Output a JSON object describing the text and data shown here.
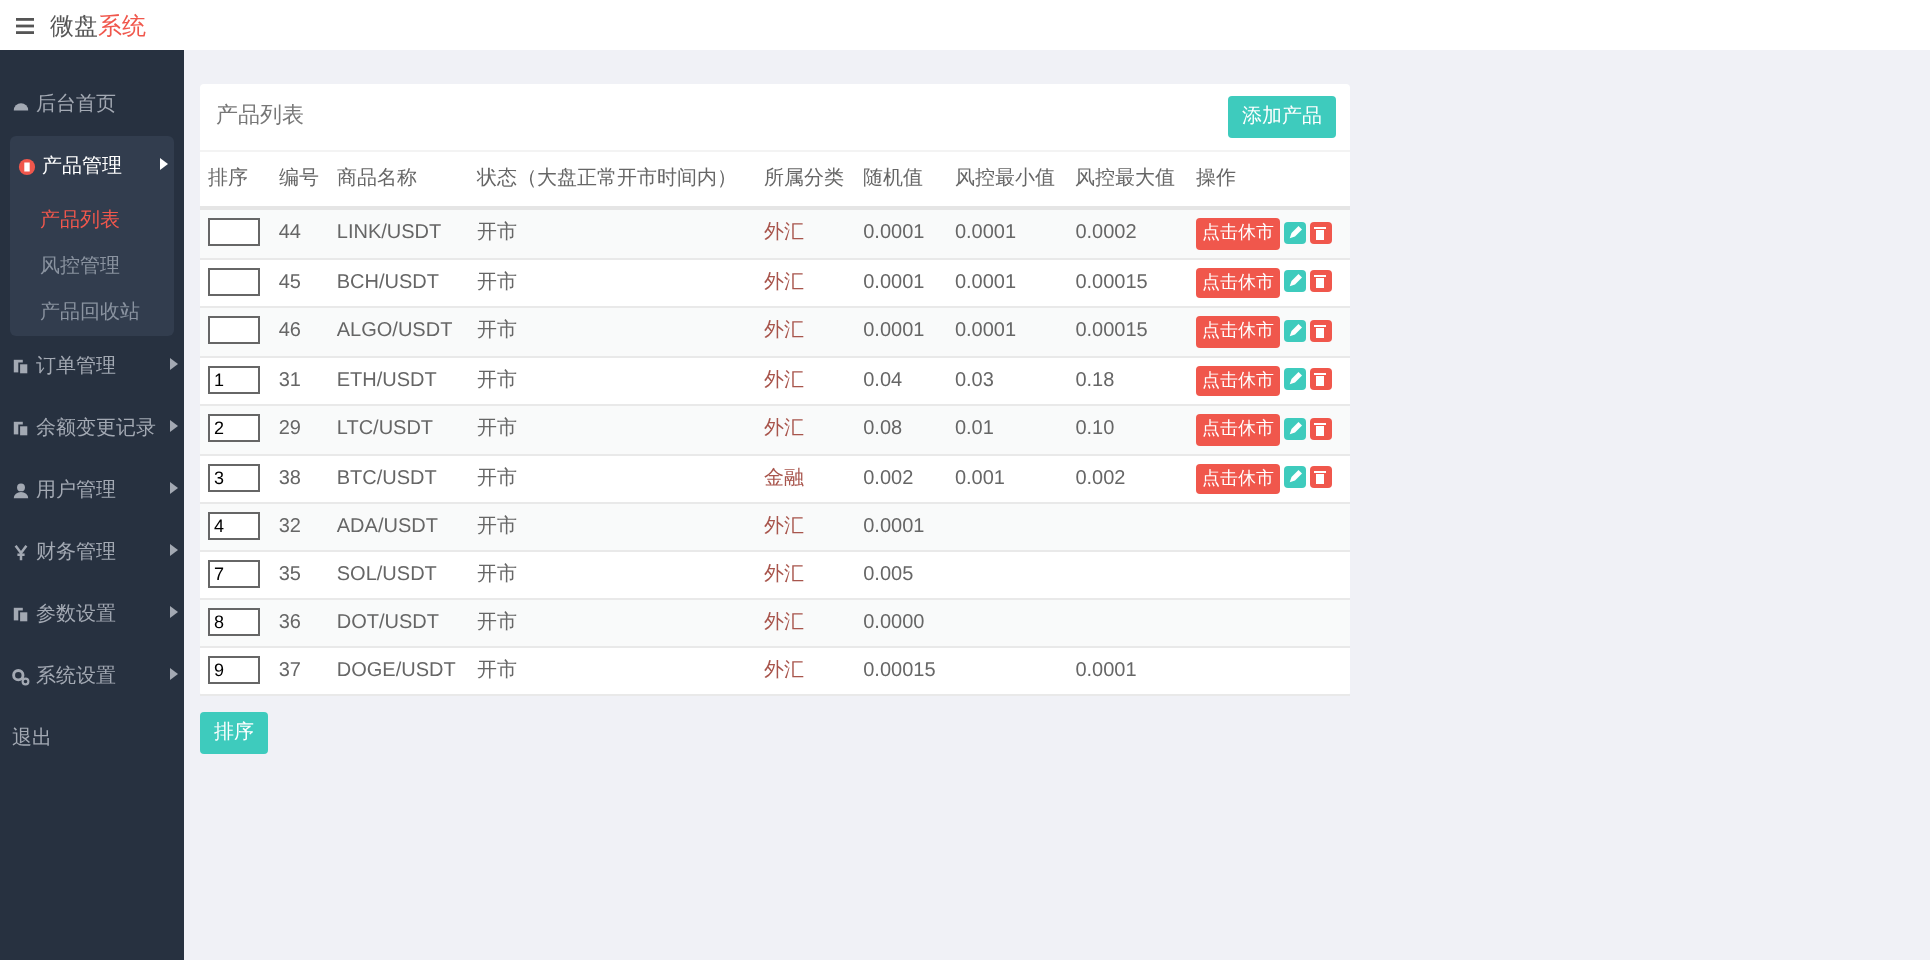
{
  "header": {
    "brand": "微盘",
    "brand_accent": "系统"
  },
  "sidebar": {
    "items": [
      {
        "label": "后台首页",
        "kind": "dashboard",
        "selected": false,
        "expanded": false,
        "has_children": false
      },
      {
        "label": "产品管理",
        "kind": "coin",
        "selected": true,
        "expanded": true,
        "has_children": true,
        "children": [
          {
            "label": "产品列表",
            "selected": true
          },
          {
            "label": "风控管理",
            "selected": false
          },
          {
            "label": "产品回收站",
            "selected": false
          }
        ]
      },
      {
        "label": "订单管理",
        "kind": "docs",
        "selected": false,
        "expanded": false,
        "has_children": true
      },
      {
        "label": "余额变更记录",
        "kind": "docs",
        "selected": false,
        "expanded": false,
        "has_children": true
      },
      {
        "label": "用户管理",
        "kind": "user",
        "selected": false,
        "expanded": false,
        "has_children": true
      },
      {
        "label": "财务管理",
        "kind": "yen",
        "selected": false,
        "expanded": false,
        "has_children": true
      },
      {
        "label": "参数设置",
        "kind": "docs",
        "selected": false,
        "expanded": false,
        "has_children": true
      },
      {
        "label": "系统设置",
        "kind": "gears",
        "selected": false,
        "expanded": false,
        "has_children": true
      },
      {
        "label": "退出",
        "kind": "plain",
        "selected": false,
        "expanded": false,
        "has_children": false
      }
    ]
  },
  "card": {
    "title": "产品列表",
    "add_button": "添加产品"
  },
  "table": {
    "columns": [
      "排序",
      "编号",
      "商品名称",
      "状态（大盘正常开市时间内）",
      "所属分类",
      "随机值",
      "风控最小值",
      "风控最大值",
      "操作"
    ],
    "rows": [
      {
        "sort": "",
        "id": "44",
        "name": "LINK/USDT",
        "status": "开市",
        "category": "外汇",
        "random": "0.0001",
        "min": "0.0001",
        "max": "0.0002",
        "toggle": "点击休市"
      },
      {
        "sort": "",
        "id": "45",
        "name": "BCH/USDT",
        "status": "开市",
        "category": "外汇",
        "random": "0.0001",
        "min": "0.0001",
        "max": "0.00015",
        "toggle": "点击休市"
      },
      {
        "sort": "",
        "id": "46",
        "name": "ALGO/USDT",
        "status": "开市",
        "category": "外汇",
        "random": "0.0001",
        "min": "0.0001",
        "max": "0.00015",
        "toggle": "点击休市"
      },
      {
        "sort": "1",
        "id": "31",
        "name": "ETH/USDT",
        "status": "开市",
        "category": "外汇",
        "random": "0.04",
        "min": "0.03",
        "max": "0.18",
        "toggle": "点击休市"
      },
      {
        "sort": "2",
        "id": "29",
        "name": "LTC/USDT",
        "status": "开市",
        "category": "外汇",
        "random": "0.08",
        "min": "0.01",
        "max": "0.10",
        "toggle": "点击休市"
      },
      {
        "sort": "3",
        "id": "38",
        "name": "BTC/USDT",
        "status": "开市",
        "category": "金融",
        "random": "0.002",
        "min": "0.001",
        "max": "0.002",
        "toggle": "点击休市"
      },
      {
        "sort": "4",
        "id": "32",
        "name": "ADA/USDT",
        "status": "开市",
        "category": "外汇",
        "random": "0.0001"
      },
      {
        "sort": "7",
        "id": "35",
        "name": "SOL/USDT",
        "status": "开市",
        "category": "外汇",
        "random": "0.005"
      },
      {
        "sort": "8",
        "id": "36",
        "name": "DOT/USDT",
        "status": "开市",
        "category": "外汇",
        "random": "0.0000"
      },
      {
        "sort": "9",
        "id": "37",
        "name": "DOGE/USDT",
        "status": "开市",
        "category": "外汇",
        "random": "0.00015",
        "max": "0.0001"
      }
    ]
  },
  "sort_button": "排序"
}
